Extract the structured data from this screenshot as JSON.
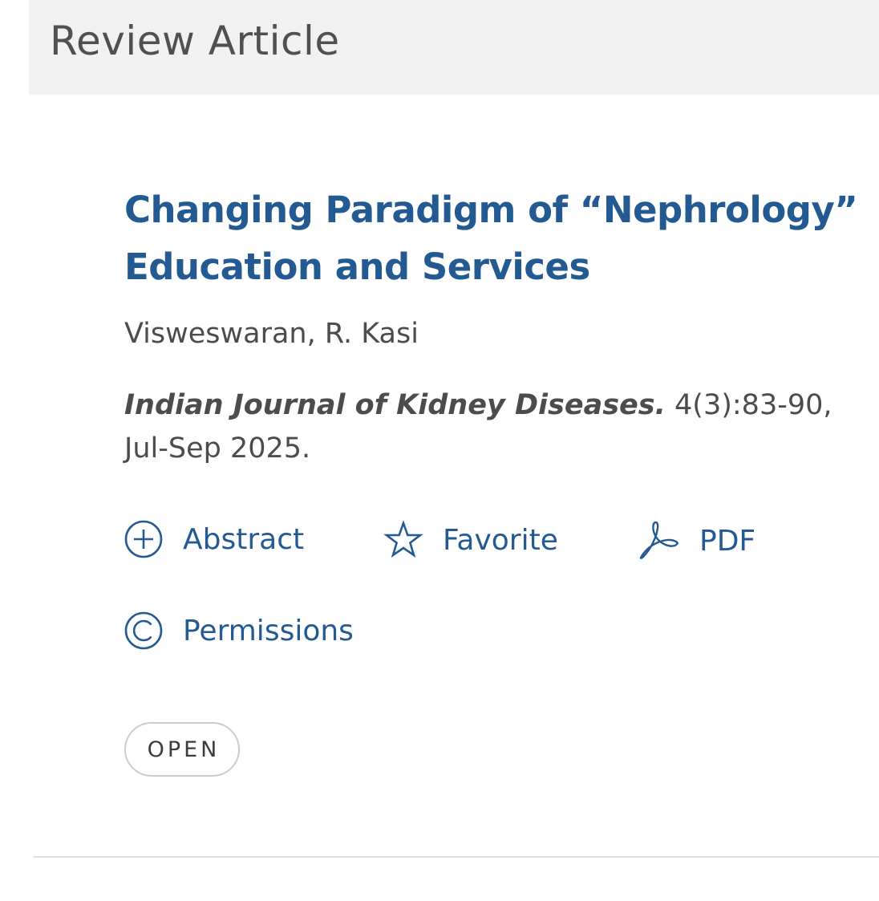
{
  "section_header": {
    "label": "Review Article"
  },
  "article": {
    "title": "Changing Paradigm of “Nephrology” Education and Services",
    "authors": "Visweswaran, R. Kasi",
    "citation": {
      "journal": "Indian Journal of Kidney Diseases.",
      "details": " 4(3):83-90, Jul-Sep 2025."
    }
  },
  "actions": {
    "abstract": {
      "label": "Abstract",
      "icon": "plus-circle-icon"
    },
    "favorite": {
      "label": "Favorite",
      "icon": "star-outline-icon"
    },
    "pdf": {
      "label": "PDF",
      "icon": "pdf-icon"
    },
    "permissions": {
      "label": "Permissions",
      "icon": "copyright-icon"
    }
  },
  "badge": {
    "label": "OPEN"
  },
  "colors": {
    "link": "#245a92",
    "header_background": "#f1f1f1",
    "text": "#4c4c4c"
  }
}
